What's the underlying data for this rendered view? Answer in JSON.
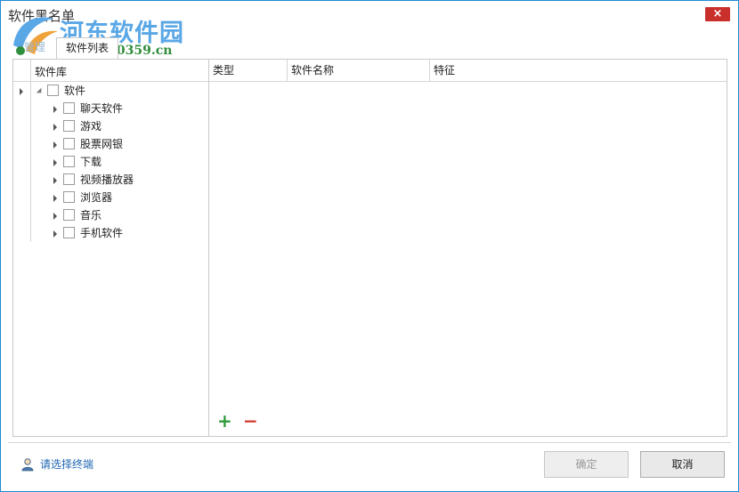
{
  "window": {
    "title": "软件黑名单",
    "close_label": "×"
  },
  "watermark": {
    "site_name": "河东软件园",
    "site_url": "www.pc0359.cn"
  },
  "tabs": [
    {
      "label": "管理",
      "active": false
    },
    {
      "label": "软件列表",
      "active": true
    }
  ],
  "tree": {
    "header": "软件库",
    "root": {
      "label": "软件",
      "expanded": true,
      "checked": false
    },
    "children": [
      {
        "label": "聊天软件",
        "checked": false
      },
      {
        "label": "游戏",
        "checked": false
      },
      {
        "label": "股票网银",
        "checked": false
      },
      {
        "label": "下载",
        "checked": false
      },
      {
        "label": "视频播放器",
        "checked": false
      },
      {
        "label": "浏览器",
        "checked": false
      },
      {
        "label": "音乐",
        "checked": false
      },
      {
        "label": "手机软件",
        "checked": false
      }
    ]
  },
  "grid": {
    "columns": [
      "类型",
      "软件名称",
      "特征"
    ],
    "rows": []
  },
  "toolbar": {
    "add_icon": "plus-icon",
    "add_label": "+",
    "remove_icon": "minus-icon",
    "remove_label": "−"
  },
  "footer": {
    "terminal_link": "请选择终端",
    "ok_label": "确定",
    "cancel_label": "取消",
    "ok_enabled": false
  },
  "colors": {
    "accent": "#1e8ad6",
    "close": "#c9302c",
    "add": "#2e9a3a",
    "remove": "#d23b30",
    "link": "#1f66b3"
  }
}
